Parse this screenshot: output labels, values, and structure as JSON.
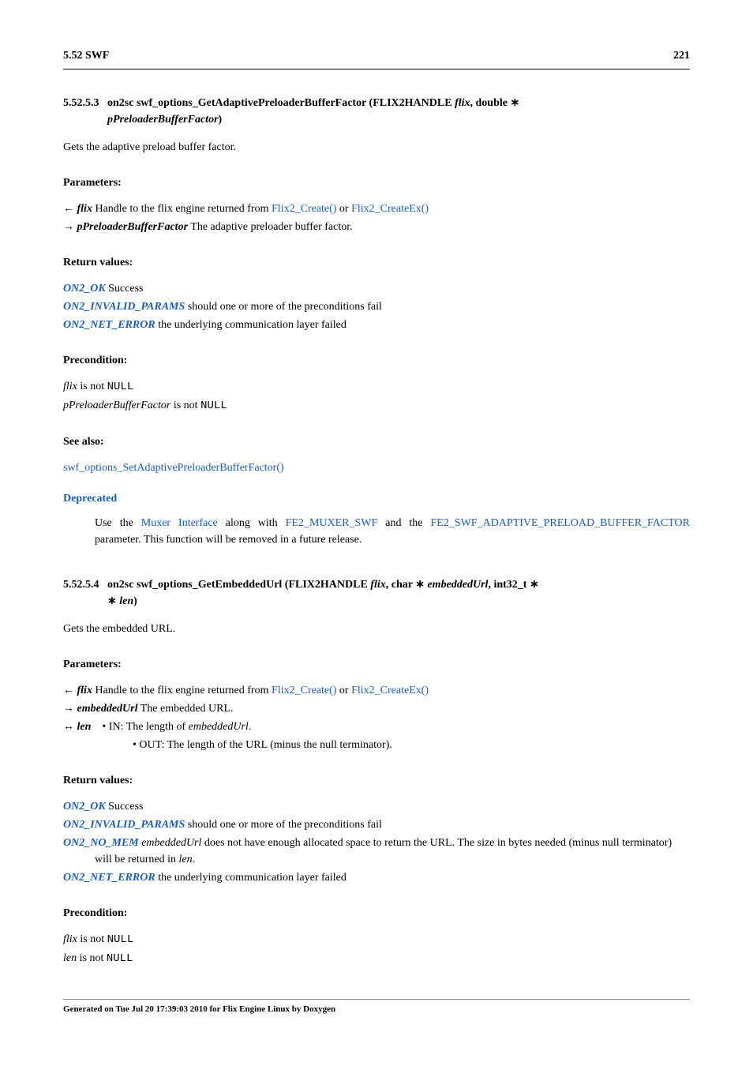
{
  "hdr": {
    "left": "5.52 SWF",
    "right": "221"
  },
  "s1": {
    "num": "5.52.5.3",
    "sig_a": "on2sc swf_options_GetAdaptivePreloaderBufferFactor (FLIX2HANDLE ",
    "sig_b": "flix",
    "sig_c": ", double ∗",
    "sig_d": "pPreloaderBufferFactor",
    "sig_e": ")",
    "desc": "Gets the adaptive preload buffer factor.",
    "params_h": "Parameters:",
    "p1_a": "← ",
    "p1_b": "flix",
    "p1_c": "  Handle to the flix engine returned from ",
    "p1_l1": "Flix2_Create()",
    "p1_d": " or ",
    "p1_l2": "Flix2_CreateEx()",
    "p2_a": "→ ",
    "p2_b": "pPreloaderBufferFactor",
    "p2_c": "  The adaptive preloader buffer factor.",
    "rv_h": "Return values:",
    "rv1_l": "ON2_OK",
    "rv1_t": "  Success",
    "rv2_l": "ON2_INVALID_PARAMS",
    "rv2_t": "  should one or more of the preconditions fail",
    "rv3_l": "ON2_NET_ERROR",
    "rv3_t": "  the underlying communication layer failed",
    "pre_h": "Precondition:",
    "pre1_a": "flix",
    "pre1_b": " is not ",
    "pre1_c": "NULL",
    "pre2_a": "pPreloaderBufferFactor",
    "pre2_b": " is not ",
    "pre2_c": "NULL",
    "see_h": "See also:",
    "see_l": "swf_options_SetAdaptivePreloaderBufferFactor()",
    "dep_h": "Deprecated",
    "dep_a": "Use the ",
    "dep_l1": "Muxer Interface",
    "dep_b": " along with ",
    "dep_l2": "FE2_MUXER_SWF",
    "dep_c": " and the ",
    "dep_l3": "FE2_SWF_ADAPTIVE_PRELOAD_BUFFER_FACTOR",
    "dep_d": " parameter. This function will be removed in a future release."
  },
  "s2": {
    "num": "5.52.5.4",
    "sig_a": "on2sc swf_options_GetEmbeddedUrl (FLIX2HANDLE ",
    "sig_b": "flix",
    "sig_c": ", char ∗ ",
    "sig_d": "embeddedUrl",
    "sig_e": ", int32_t ∗ ",
    "sig_f": "len",
    "sig_g": ")",
    "desc": "Gets the embedded URL.",
    "params_h": "Parameters:",
    "p1_a": "← ",
    "p1_b": "flix",
    "p1_c": "  Handle to the flix engine returned from ",
    "p1_l1": "Flix2_Create()",
    "p1_d": " or ",
    "p1_l2": "Flix2_CreateEx()",
    "p2_a": "→ ",
    "p2_b": "embeddedUrl",
    "p2_c": "  The embedded URL.",
    "p3_a": "↔ ",
    "p3_b": "len",
    "p3_bul1_a": "• IN: The length of ",
    "p3_bul1_b": "embeddedUrl",
    "p3_bul1_c": ".",
    "p3_bul2": "• OUT: The length of the URL (minus the null terminator).",
    "rv_h": "Return values:",
    "rv1_l": "ON2_OK",
    "rv1_t": "  Success",
    "rv2_l": "ON2_INVALID_PARAMS",
    "rv2_t": "  should one or more of the preconditions fail",
    "rv3_l": "ON2_NO_MEM",
    "rv3_t_a": "embeddedUrl",
    "rv3_t_b": " does not have enough allocated space to return the URL. The size in bytes needed (minus null terminator) will be returned in ",
    "rv3_t_c": "len",
    "rv3_t_d": ".",
    "rv4_l": "ON2_NET_ERROR",
    "rv4_t": "  the underlying communication layer failed",
    "pre_h": "Precondition:",
    "pre1_a": "flix",
    "pre1_b": " is not ",
    "pre1_c": "NULL",
    "pre2_a": "len",
    "pre2_b": " is not ",
    "pre2_c": "NULL"
  },
  "footer": "Generated on Tue Jul 20 17:39:03 2010 for Flix Engine Linux by Doxygen"
}
